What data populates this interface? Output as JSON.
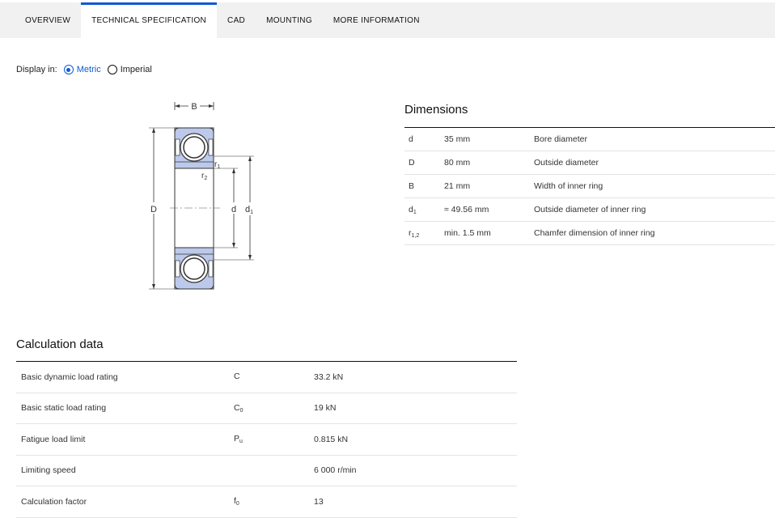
{
  "tabs": [
    {
      "label": "OVERVIEW",
      "active": false
    },
    {
      "label": "TECHNICAL SPECIFICATION",
      "active": true
    },
    {
      "label": "CAD",
      "active": false
    },
    {
      "label": "MOUNTING",
      "active": false
    },
    {
      "label": "MORE INFORMATION",
      "active": false
    }
  ],
  "display": {
    "label": "Display in:",
    "options": [
      {
        "label": "Metric",
        "selected": true
      },
      {
        "label": "Imperial",
        "selected": false
      }
    ]
  },
  "drawing": {
    "labels": {
      "B": "B",
      "D": "D",
      "d": "d",
      "d1": "d",
      "d1_sub": "1",
      "r1": "r",
      "r1_sub": "1",
      "r2": "r",
      "r2_sub": "2"
    }
  },
  "dimensions": {
    "title": "Dimensions",
    "rows": [
      {
        "symbol": "d",
        "sub": "",
        "value": "35 mm",
        "description": "Bore diameter"
      },
      {
        "symbol": "D",
        "sub": "",
        "value": "80 mm",
        "description": "Outside diameter"
      },
      {
        "symbol": "B",
        "sub": "",
        "value": "21 mm",
        "description": "Width of inner ring"
      },
      {
        "symbol": "d",
        "sub": "1",
        "value": "≈ 49.56 mm",
        "description": "Outside diameter of inner ring"
      },
      {
        "symbol": "r",
        "sub": "1,2",
        "value": "min. 1.5 mm",
        "description": "Chamfer dimension of inner ring"
      }
    ]
  },
  "calculation": {
    "title": "Calculation data",
    "rows": [
      {
        "name": "Basic dynamic load rating",
        "symbol": "C",
        "sub": "",
        "value": "33.2 kN"
      },
      {
        "name": "Basic static load rating",
        "symbol": "C",
        "sub": "0",
        "value": "19 kN"
      },
      {
        "name": "Fatigue load limit",
        "symbol": "P",
        "sub": "u",
        "value": "0.815 kN"
      },
      {
        "name": "Limiting speed",
        "symbol": "",
        "sub": "",
        "value": "6 000 r/min"
      },
      {
        "name": "Calculation factor",
        "symbol": "f",
        "sub": "0",
        "value": "13"
      }
    ]
  },
  "colors": {
    "accent": "#0f58d6",
    "ring_fill": "#bcc9ea",
    "tab_bg": "#f1f1f1"
  }
}
